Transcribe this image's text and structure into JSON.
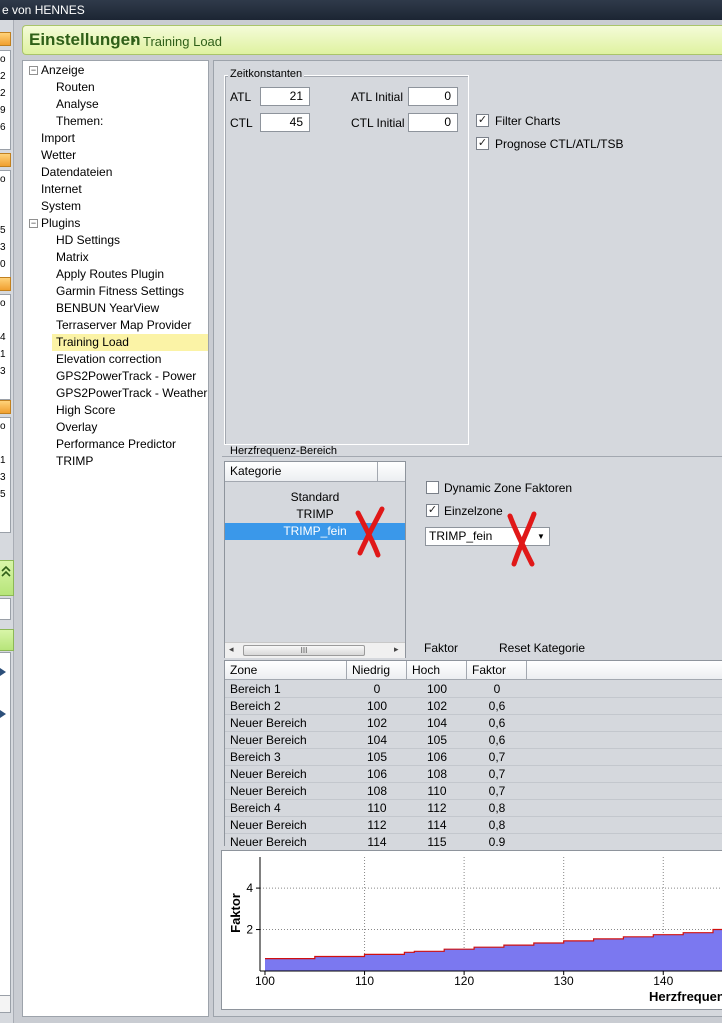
{
  "window": {
    "title": "e von HENNES"
  },
  "left_strip": {
    "values": [
      "o",
      "2",
      "2",
      "9",
      "6",
      "o",
      "5",
      "3",
      "0",
      "o",
      "4",
      "1",
      "3",
      "o",
      "1",
      "3",
      "5"
    ]
  },
  "header": {
    "title": "Einstellungen",
    "bullet": "•",
    "subtitle": "Training Load"
  },
  "tree": {
    "items": [
      {
        "label": "Anzeige",
        "expander": "−"
      },
      {
        "label": "Routen"
      },
      {
        "label": "Analyse"
      },
      {
        "label": "Themen:"
      },
      {
        "label": "Import"
      },
      {
        "label": "Wetter"
      },
      {
        "label": "Datendateien"
      },
      {
        "label": "Internet"
      },
      {
        "label": "System"
      },
      {
        "label": "Plugins",
        "expander": "−"
      },
      {
        "label": "HD Settings"
      },
      {
        "label": "Matrix"
      },
      {
        "label": "Apply Routes Plugin"
      },
      {
        "label": "Garmin Fitness Settings"
      },
      {
        "label": "BENBUN YearView"
      },
      {
        "label": "Terraserver Map Provider"
      },
      {
        "label": "Training Load"
      },
      {
        "label": "Elevation correction"
      },
      {
        "label": "GPS2PowerTrack - Power"
      },
      {
        "label": "GPS2PowerTrack - Weather"
      },
      {
        "label": "High Score"
      },
      {
        "label": "Overlay"
      },
      {
        "label": "Performance Predictor"
      },
      {
        "label": "TRIMP"
      }
    ]
  },
  "time_constants": {
    "group_label": "Zeitkonstanten",
    "atl_label": "ATL",
    "atl_value": "21",
    "ctl_label": "CTL",
    "ctl_value": "45",
    "atl_initial_label": "ATL Initial",
    "atl_initial_value": "0",
    "ctl_initial_label": "CTL Initial",
    "ctl_initial_value": "0",
    "filter_charts_label": "Filter Charts",
    "filter_charts_checked": "✓",
    "prognose_label": "Prognose CTL/ATL/TSB",
    "prognose_checked": "✓"
  },
  "hr_range": {
    "group_label": "Herzfrequenz-Bereich",
    "category_header": "Kategorie",
    "categories": [
      "Standard",
      "TRIMP",
      "TRIMP_fein"
    ],
    "selected_category": "TRIMP_fein",
    "dynamic_zone_label": "Dynamic Zone Faktoren",
    "single_zone_label": "Einzelzone",
    "single_zone_checked": "✓",
    "zone_select_value": "TRIMP_fein",
    "dropdown_icon": "▼",
    "scroll_left": "◂",
    "scroll_right": "▸",
    "scroll_grip": "III",
    "factor_button": "Faktor",
    "reset_button": "Reset Kategorie"
  },
  "zone_table": {
    "headers": [
      "Zone",
      "Niedrig",
      "Hoch",
      "Faktor"
    ],
    "rows": [
      [
        "Bereich 1",
        "0",
        "100",
        "0"
      ],
      [
        "Bereich 2",
        "100",
        "102",
        "0,6"
      ],
      [
        "Neuer Bereich",
        "102",
        "104",
        "0,6"
      ],
      [
        "Neuer Bereich",
        "104",
        "105",
        "0,6"
      ],
      [
        "Bereich 3",
        "105",
        "106",
        "0,7"
      ],
      [
        "Neuer Bereich",
        "106",
        "108",
        "0,7"
      ],
      [
        "Neuer Bereich",
        "108",
        "110",
        "0,7"
      ],
      [
        "Bereich 4",
        "110",
        "112",
        "0,8"
      ],
      [
        "Neuer Bereich",
        "112",
        "114",
        "0,8"
      ],
      [
        "Neuer Bereich",
        "114",
        "115",
        "0,9"
      ]
    ]
  },
  "colors": {
    "accent_green": "#2f5f18",
    "selection_blue": "#3a98ea",
    "chart_fill": "#7b78f0",
    "chart_line": "#d01010",
    "annotation_red": "#e01818"
  },
  "chart_data": {
    "type": "area",
    "title": "",
    "xlabel": "Herzfrequenz",
    "ylabel": "Faktor",
    "xlim": [
      99.5,
      146
    ],
    "ylim": [
      0,
      5.5
    ],
    "x_ticks": [
      "100",
      "110",
      "120",
      "130",
      "140"
    ],
    "y_ticks": [
      "2",
      "4"
    ],
    "grid": "vertical dotted",
    "series": [
      {
        "steps": [
          {
            "x0": 100,
            "x1": 102,
            "y": 0.6
          },
          {
            "x0": 102,
            "x1": 104,
            "y": 0.6
          },
          {
            "x0": 104,
            "x1": 105,
            "y": 0.6
          },
          {
            "x0": 105,
            "x1": 106,
            "y": 0.7
          },
          {
            "x0": 106,
            "x1": 108,
            "y": 0.7
          },
          {
            "x0": 108,
            "x1": 110,
            "y": 0.7
          },
          {
            "x0": 110,
            "x1": 112,
            "y": 0.8
          },
          {
            "x0": 112,
            "x1": 114,
            "y": 0.8
          },
          {
            "x0": 114,
            "x1": 115,
            "y": 0.9
          },
          {
            "x0": 115,
            "x1": 118,
            "y": 0.95
          },
          {
            "x0": 118,
            "x1": 121,
            "y": 1.05
          },
          {
            "x0": 121,
            "x1": 124,
            "y": 1.15
          },
          {
            "x0": 124,
            "x1": 127,
            "y": 1.25
          },
          {
            "x0": 127,
            "x1": 130,
            "y": 1.35
          },
          {
            "x0": 130,
            "x1": 133,
            "y": 1.45
          },
          {
            "x0": 133,
            "x1": 136,
            "y": 1.55
          },
          {
            "x0": 136,
            "x1": 139,
            "y": 1.65
          },
          {
            "x0": 139,
            "x1": 142,
            "y": 1.75
          },
          {
            "x0": 142,
            "x1": 145,
            "y": 1.85
          },
          {
            "x0": 145,
            "x1": 146,
            "y": 2.0
          }
        ]
      }
    ]
  }
}
